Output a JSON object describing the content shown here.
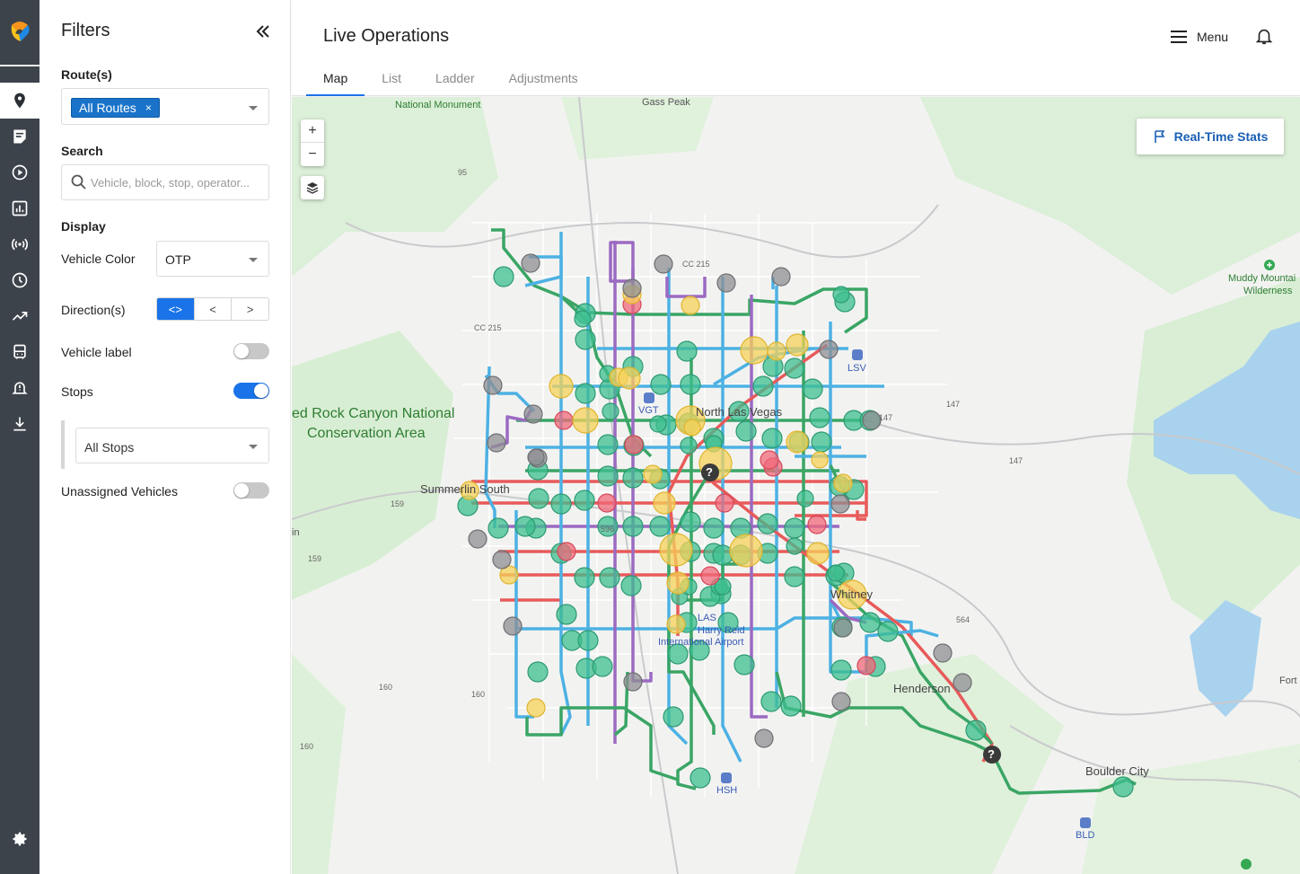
{
  "app": {
    "accent": "#1a73e8",
    "rail_bg": "#3d434b"
  },
  "rail": {
    "items": [
      {
        "name": "map-pin-icon"
      },
      {
        "name": "notes-icon"
      },
      {
        "name": "play-circle-icon"
      },
      {
        "name": "bar-chart-icon"
      },
      {
        "name": "broadcast-icon"
      },
      {
        "name": "clock-icon"
      },
      {
        "name": "trending-icon"
      },
      {
        "name": "bus-icon"
      },
      {
        "name": "alert-bell-icon"
      },
      {
        "name": "download-icon"
      }
    ],
    "settings": {
      "name": "gear-icon"
    }
  },
  "filters": {
    "title": "Filters",
    "routes_label": "Route(s)",
    "routes_chip": "All Routes",
    "chip_remove": "×",
    "search_label": "Search",
    "search_placeholder": "Vehicle, block, stop, operator...",
    "display_label": "Display",
    "vehicle_color_label": "Vehicle Color",
    "vehicle_color_value": "OTP",
    "direction_label": "Direction(s)",
    "direction_options": [
      "<>",
      "<",
      ">"
    ],
    "vehicle_label_label": "Vehicle label",
    "vehicle_label_on": false,
    "stops_label": "Stops",
    "stops_on": true,
    "stops_select_value": "All Stops",
    "unassigned_label": "Unassigned Vehicles",
    "unassigned_on": false
  },
  "header": {
    "title": "Live Operations",
    "tabs": [
      {
        "label": "Map",
        "active": true
      },
      {
        "label": "List",
        "active": false
      },
      {
        "label": "Ladder",
        "active": false
      },
      {
        "label": "Adjustments",
        "active": false
      }
    ],
    "menu_label": "Menu"
  },
  "map": {
    "zoom_in": "+",
    "zoom_out": "−",
    "realtime_stats": "Real-Time Stats",
    "labels": {
      "national_monument": "National Monument",
      "gass_peak": "Gass Peak",
      "muddy_1": "Muddy Mountai",
      "muddy_2": "Wilderness",
      "red_rock_1": "ed Rock Canyon National",
      "red_rock_2": "Conservation Area",
      "summerlin": "Summerlin South",
      "north_lv": "North Las Vegas",
      "whitney": "Whitney",
      "henderson": "Henderson",
      "boulder": "Boulder City",
      "lsv": "LSV",
      "vgt": "VGT",
      "las": "LAS",
      "airport_1": "Harry Reid",
      "airport_2": "International Airport",
      "hsh": "HSH",
      "bld": "BLD",
      "fort": "Fort",
      "in": "in",
      "r95": "95",
      "cc215a": "CC 215",
      "cc215b": "CC 215",
      "r147a": "147",
      "r147b": "147",
      "r147c": "147",
      "r159a": "159",
      "r159b": "159",
      "r160a": "160",
      "r160b": "160",
      "r160c": "160",
      "r564": "564",
      "r596": "596"
    },
    "unassigned_marker": "?",
    "colors": {
      "on_time": "#3dbf8f",
      "late": "#f06a7a",
      "early": "#f5d15a",
      "no_data": "#8f8f93",
      "route_green": "#3aa565",
      "route_blue": "#4db1e3",
      "route_purple": "#9b6ac2",
      "route_red": "#e85a5a"
    }
  }
}
